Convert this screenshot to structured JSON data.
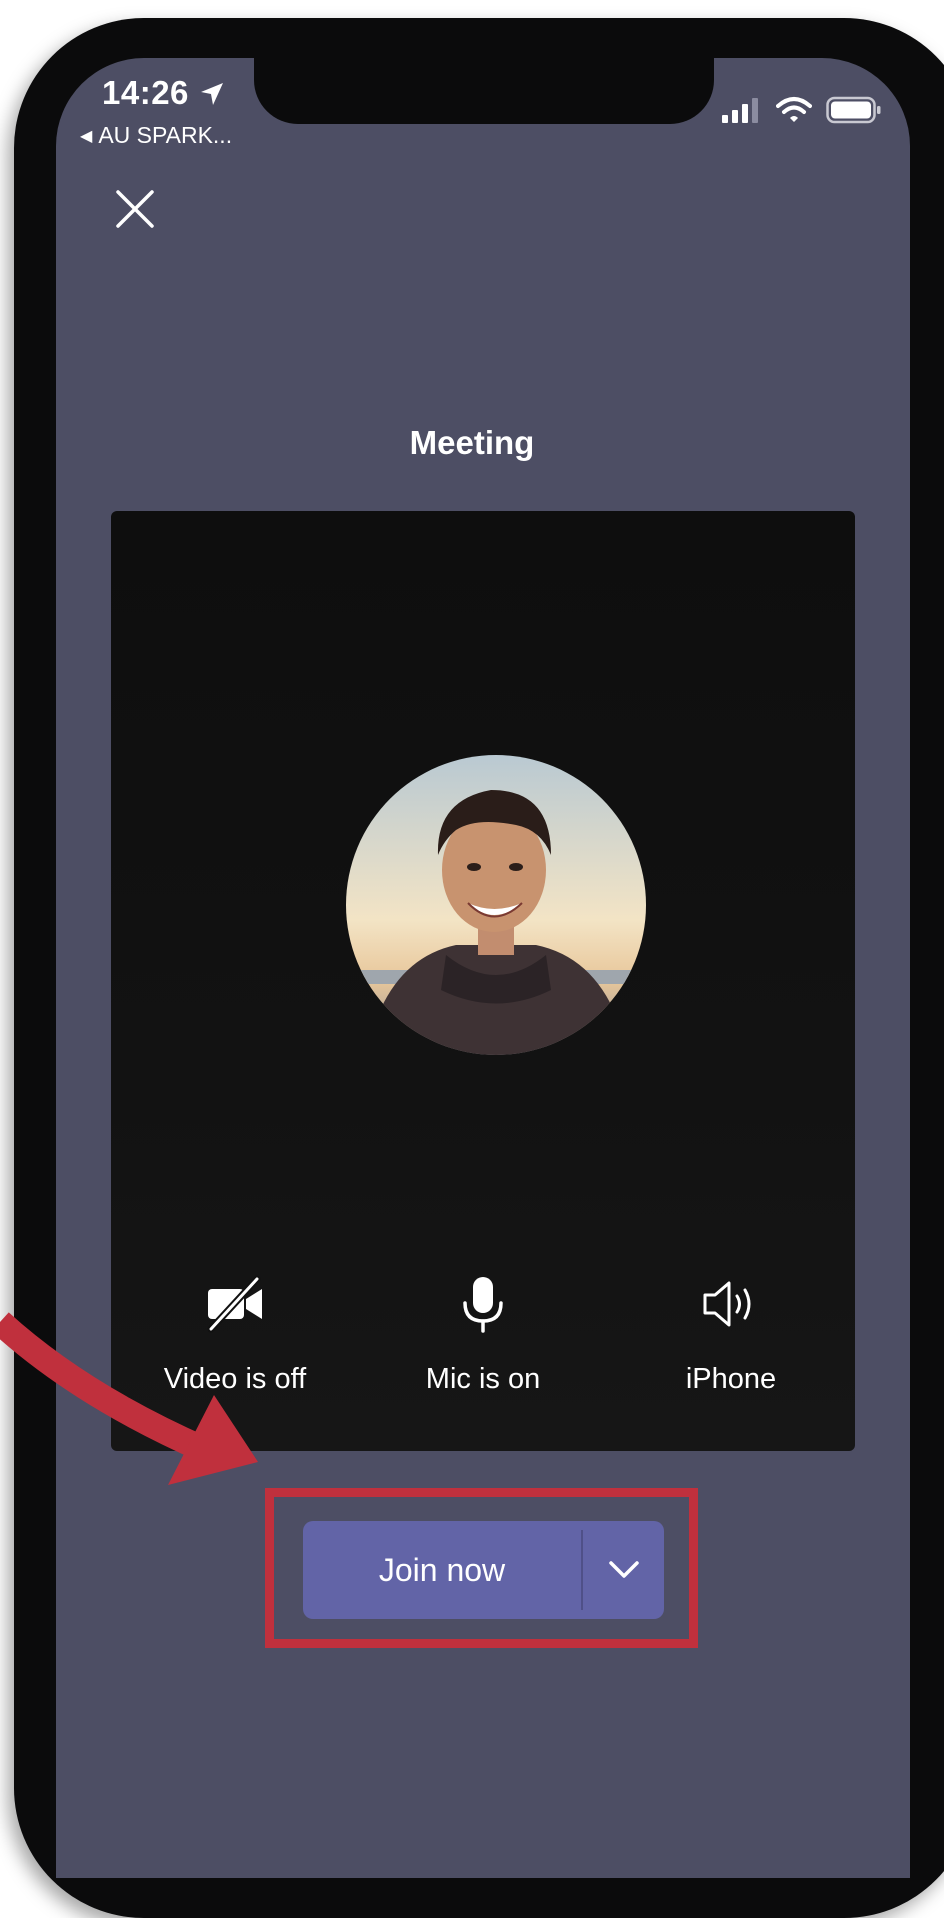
{
  "status_bar": {
    "time": "14:26",
    "back_app_label": "AU SPARK..."
  },
  "header": {
    "title": "Meeting"
  },
  "controls": [
    {
      "label": "Video is off",
      "icon": "video-off-icon"
    },
    {
      "label": "Mic is on",
      "icon": "mic-icon"
    },
    {
      "label": "iPhone",
      "icon": "speaker-icon"
    }
  ],
  "join": {
    "label": "Join now"
  },
  "colors": {
    "background": "#4d4e64",
    "video_panel": "#111111",
    "join_button": "#6264a7",
    "annotation": "#c0303d"
  }
}
